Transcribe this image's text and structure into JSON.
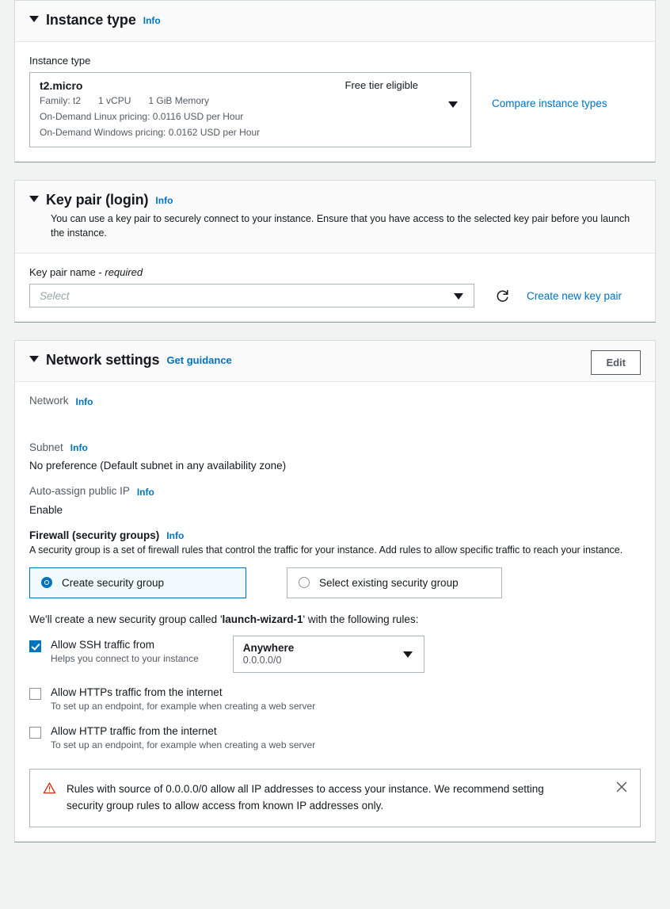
{
  "instance_type_section": {
    "title": "Instance type",
    "info_label": "Info",
    "caret_icon": "chevron-down-icon",
    "field_label": "Instance type",
    "selected": {
      "name": "t2.micro",
      "free_tier": "Free tier eligible",
      "family": "Family: t2",
      "vcpu": "1 vCPU",
      "memory": "1 GiB Memory",
      "linux_pricing": "On-Demand Linux pricing: 0.0116 USD per Hour",
      "windows_pricing": "On-Demand Windows pricing: 0.0162 USD per Hour"
    },
    "compare_link": "Compare instance types"
  },
  "key_pair_section": {
    "title": "Key pair (login)",
    "info_label": "Info",
    "description": "You can use a key pair to securely connect to your instance. Ensure that you have access to the selected key pair before you launch the instance.",
    "field_label": "Key pair name - ",
    "field_label_required": "required",
    "select_placeholder": "Select",
    "select_value": "",
    "refresh_icon": "refresh-icon",
    "create_link": "Create new key pair"
  },
  "network_section": {
    "title": "Network settings",
    "guidance_link": "Get guidance",
    "edit_button": "Edit",
    "network": {
      "label": "Network",
      "info_label": "Info",
      "value": ""
    },
    "subnet": {
      "label": "Subnet",
      "info_label": "Info",
      "value": "No preference (Default subnet in any availability zone)"
    },
    "auto_assign_ip": {
      "label": "Auto-assign public IP",
      "info_label": "Info",
      "value": "Enable"
    },
    "firewall": {
      "title": "Firewall (security groups)",
      "info_label": "Info",
      "description": "A security group is a set of firewall rules that control the traffic for your instance. Add rules to allow specific traffic to reach your instance.",
      "options": [
        {
          "label": "Create security group",
          "selected": true
        },
        {
          "label": "Select existing security group",
          "selected": false
        }
      ],
      "note_prefix": "We'll create a new security group called '",
      "note_name": "launch-wizard-1",
      "note_suffix": "' with the following rules:",
      "rules": [
        {
          "label": "Allow SSH traffic from",
          "sublabel": "Helps you connect to your instance",
          "checked": true,
          "source": {
            "value": "Anywhere",
            "cidr": "0.0.0.0/0"
          }
        },
        {
          "label": "Allow HTTPs traffic from the internet",
          "sublabel": "To set up an endpoint, for example when creating a web server",
          "checked": false
        },
        {
          "label": "Allow HTTP traffic from the internet",
          "sublabel": "To set up an endpoint, for example when creating a web server",
          "checked": false
        }
      ],
      "alert": {
        "icon": "warning-triangle-icon",
        "text": "Rules with source of 0.0.0.0/0 allow all IP addresses to access your instance. We recommend setting security group rules to allow access from known IP addresses only.",
        "close_icon": "close-icon"
      }
    }
  },
  "colors": {
    "link": "#0073bb",
    "page_bg": "#f1f3f3",
    "card_bg": "#ffffff",
    "selected_radio_bg": "#f1faff",
    "warning": "#d13212"
  }
}
